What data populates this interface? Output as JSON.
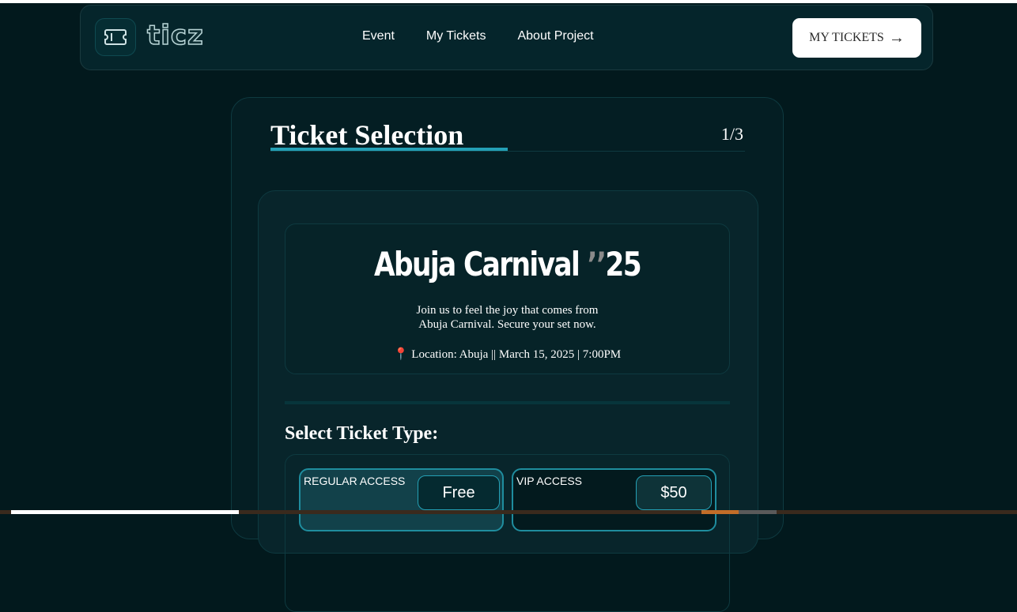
{
  "header": {
    "logo_text": "ticz",
    "nav_links": [
      "Event",
      "My Tickets",
      "About Project"
    ],
    "cta_label": "MY TICKETS",
    "cta_arrow": "→"
  },
  "page": {
    "title": "Ticket Selection",
    "step": "1/3",
    "progress": 0.33
  },
  "event": {
    "name": "Abuja Carnival",
    "year_quote": "’’",
    "year": "25",
    "description_line1": "Join us to feel the joy that comes from",
    "description_line2": "Abuja Carnival. Secure your set now.",
    "pin_icon": "📍",
    "location": "Location: Abuja",
    "separator1": "||",
    "date": "March 15, 2025",
    "separator2": "|",
    "time": "7:00PM"
  },
  "ticket_section": {
    "title": "Select Ticket Type:",
    "tickets": [
      {
        "label": "REGULAR ACCESS",
        "price": "Free",
        "selected": true
      },
      {
        "label": "VIP ACCESS",
        "price": "$50",
        "selected": false
      }
    ]
  },
  "colors": {
    "background": "#02191d",
    "accent": "#24a0b5",
    "card": "#041e23"
  }
}
